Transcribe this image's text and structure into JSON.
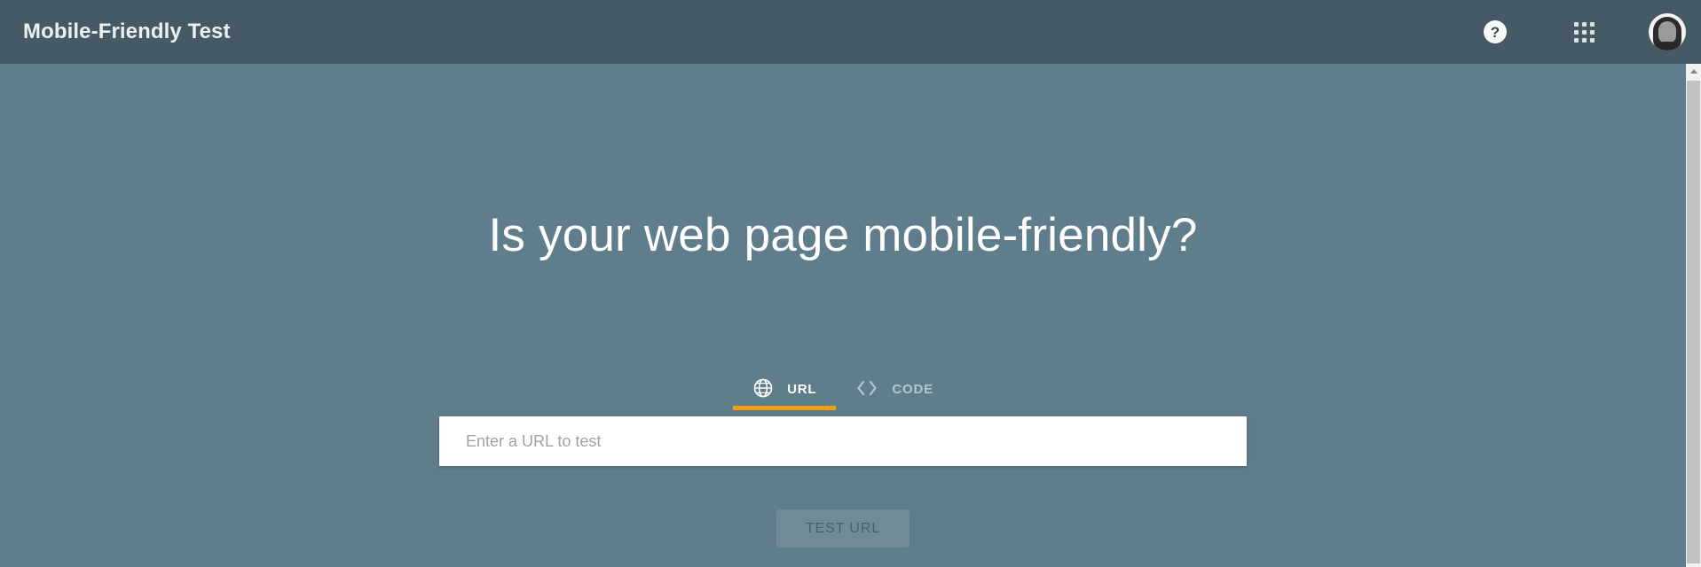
{
  "appbar": {
    "title": "Mobile-Friendly Test",
    "help_icon": "help-question-icon",
    "help_glyph": "?",
    "apps_icon": "apps-grid-icon",
    "avatar_icon": "user-avatar",
    "background_color": "#455a64"
  },
  "main": {
    "background_color": "#607d8b",
    "hero_title": "Is your web page mobile-friendly?",
    "accent_color": "#f79c0d",
    "tabs": [
      {
        "id": "url",
        "label": "URL",
        "icon": "globe-icon",
        "active": true
      },
      {
        "id": "code",
        "label": "CODE",
        "icon": "code-brackets-icon",
        "active": false
      }
    ],
    "url_field": {
      "placeholder": "Enter a URL to test",
      "value": ""
    },
    "submit_button": {
      "label": "TEST URL",
      "enabled": false
    }
  },
  "scrollbar": {
    "up_arrow_icon": "scroll-up-arrow-icon",
    "track_color": "#f1f1f1",
    "thumb_color": "#c1c1c1"
  }
}
